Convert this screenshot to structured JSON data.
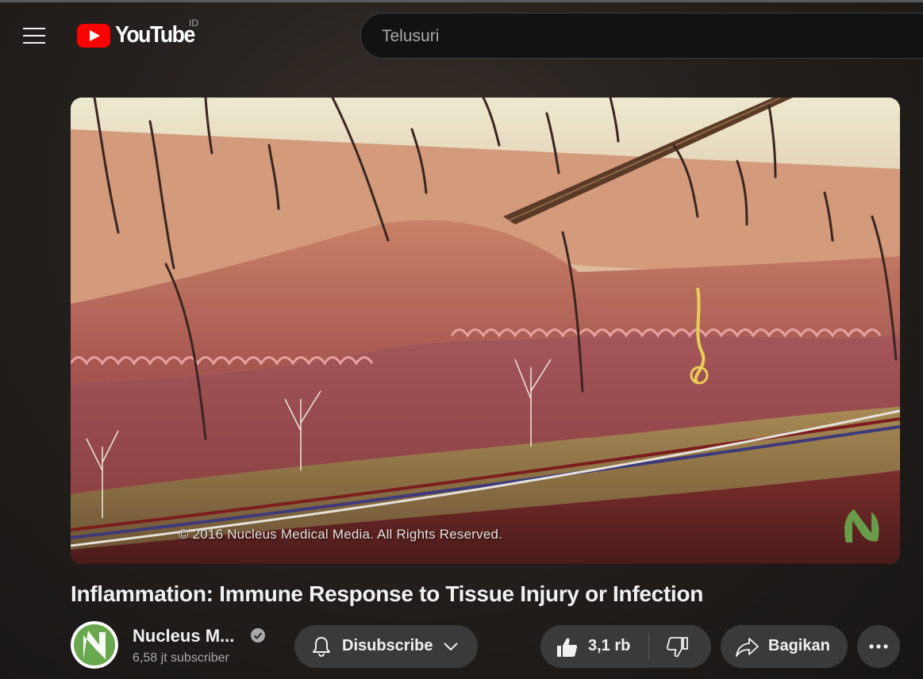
{
  "header": {
    "logo_text": "YouTube",
    "country_code": "ID",
    "search": {
      "placeholder": "Telusuri",
      "value": ""
    }
  },
  "video": {
    "watermark": "© 2016 Nucleus Medical Media.  All Rights Reserved.",
    "title": "Inflammation: Immune Response to Tissue Injury or Infection"
  },
  "channel": {
    "name": "Nucleus M...",
    "subscribers": "6,58 jt subscriber",
    "verified": true
  },
  "actions": {
    "subscribe_label": "Disubscribe",
    "like_count": "3,1 rb",
    "share_label": "Bagikan"
  },
  "colors": {
    "youtube_red": "#ff0000",
    "pill_bg": "#3a3a3a",
    "channel_green": "#6aa84f"
  },
  "icons": [
    "menu-icon",
    "youtube-play-icon",
    "bell-icon",
    "chevron-down-icon",
    "thumbs-up-icon",
    "thumbs-down-icon",
    "share-icon",
    "more-icon",
    "verified-icon"
  ]
}
